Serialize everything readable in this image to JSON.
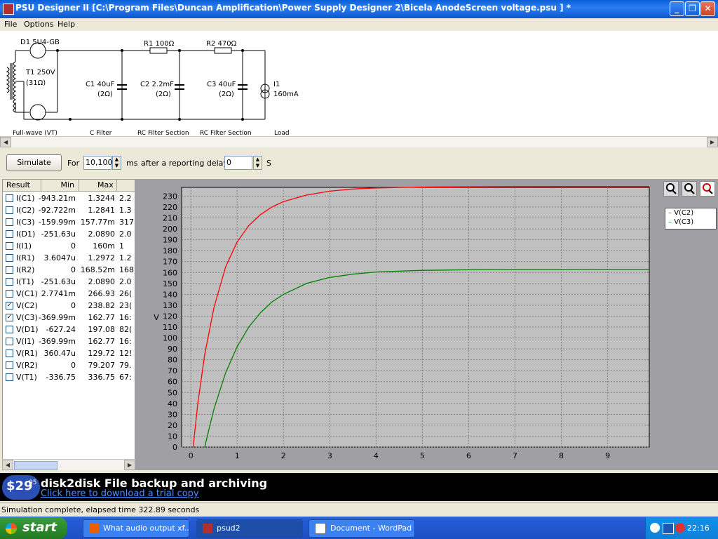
{
  "window": {
    "title": "PSU Designer II  [C:\\Program Files\\Duncan Amplification\\Power Supply Designer 2\\Bicela AnodeScreen voltage.psu ] *",
    "minimize_label": "_",
    "maximize_label": "❐",
    "close_label": "✕"
  },
  "menu": [
    "File",
    "Options",
    "Help"
  ],
  "schematic": {
    "d1": "D1 5U4-GB",
    "t1": "T1 250V",
    "t1_r": "(31Ω)",
    "r1": "R1 100Ω",
    "r2": "R2 470Ω",
    "c1": "C1 40uF",
    "c1_r": "(2Ω)",
    "c2": "C2 2.2mF",
    "c2_r": "(2Ω)",
    "c3": "C3 40uF",
    "c3_r": "(2Ω)",
    "i1": "I1",
    "i1_val": "160mA",
    "sections": [
      "Full-wave (VT)",
      "C Filter",
      "RC Filter Section",
      "RC Filter Section",
      "Load"
    ]
  },
  "controls": {
    "simulate_label": "Simulate",
    "for_label": "For",
    "duration_value": "10,100",
    "ms_label": "ms",
    "delay_label": "after a reporting delay of",
    "delay_value": "0",
    "s_label": "S"
  },
  "results": {
    "headers": [
      "Result",
      "Min",
      "Max"
    ],
    "rows": [
      {
        "name": "I(C1)",
        "min": "-943.21m",
        "max": "1.3244",
        "extra": "2.2",
        "checked": false
      },
      {
        "name": "I(C2)",
        "min": "-92.722m",
        "max": "1.2841",
        "extra": "1.3",
        "checked": false
      },
      {
        "name": "I(C3)",
        "min": "-159.99m",
        "max": "157.77m",
        "extra": "317.",
        "checked": false
      },
      {
        "name": "I(D1)",
        "min": "-251.63u",
        "max": "2.0890",
        "extra": "2.0",
        "checked": false
      },
      {
        "name": "I(I1)",
        "min": "0",
        "max": "160m",
        "extra": "1",
        "checked": false
      },
      {
        "name": "I(R1)",
        "min": "3.6047u",
        "max": "1.2972",
        "extra": "1.2",
        "checked": false
      },
      {
        "name": "I(R2)",
        "min": "0",
        "max": "168.52m",
        "extra": "168.",
        "checked": false
      },
      {
        "name": "I(T1)",
        "min": "-251.63u",
        "max": "2.0890",
        "extra": "2.0",
        "checked": false
      },
      {
        "name": "V(C1)",
        "min": "2.7741m",
        "max": "266.93",
        "extra": "26(",
        "checked": false
      },
      {
        "name": "V(C2)",
        "min": "0",
        "max": "238.82",
        "extra": "23(",
        "checked": true
      },
      {
        "name": "V(C3)",
        "min": "-369.99m",
        "max": "162.77",
        "extra": "16:",
        "checked": true
      },
      {
        "name": "V(D1)",
        "min": "-627.24",
        "max": "197.08",
        "extra": "82(",
        "checked": false
      },
      {
        "name": "V(I1)",
        "min": "-369.99m",
        "max": "162.77",
        "extra": "16:",
        "checked": false
      },
      {
        "name": "V(R1)",
        "min": "360.47u",
        "max": "129.72",
        "extra": "12!",
        "checked": false
      },
      {
        "name": "V(R2)",
        "min": "0",
        "max": "79.207",
        "extra": "79.",
        "checked": false
      },
      {
        "name": "V(T1)",
        "min": "-336.75",
        "max": "336.75",
        "extra": "67:",
        "checked": false
      }
    ]
  },
  "chart_data": {
    "type": "line",
    "ylabel": "V",
    "xlim": [
      -0.2,
      9.9
    ],
    "ylim": [
      0,
      238
    ],
    "xticks": [
      0,
      1,
      2,
      3,
      4,
      5,
      6,
      7,
      8,
      9
    ],
    "yticks": [
      0,
      10,
      20,
      30,
      40,
      50,
      60,
      70,
      80,
      90,
      100,
      110,
      120,
      130,
      140,
      150,
      160,
      170,
      180,
      190,
      200,
      210,
      220,
      230
    ],
    "grid": true,
    "legend_position": "top-right",
    "series": [
      {
        "name": "V(C2)",
        "color": "#ff0000",
        "x": [
          0.05,
          0.15,
          0.3,
          0.5,
          0.75,
          1.0,
          1.25,
          1.5,
          1.75,
          2.0,
          2.5,
          3.0,
          3.5,
          4.0,
          5.0,
          6.0,
          7.0,
          8.0,
          9.0,
          9.9
        ],
        "y": [
          0,
          40,
          85,
          128,
          165,
          188,
          203,
          213,
          220,
          225,
          231,
          234.5,
          236.5,
          237.5,
          238.3,
          238.6,
          238.7,
          238.8,
          238.8,
          238.8
        ]
      },
      {
        "name": "V(C3)",
        "color": "#008000",
        "x": [
          0.3,
          0.4,
          0.5,
          0.75,
          1.0,
          1.25,
          1.5,
          1.75,
          2.0,
          2.5,
          3.0,
          3.5,
          4.0,
          5.0,
          6.0,
          7.0,
          8.0,
          9.0,
          9.9
        ],
        "y": [
          0,
          18,
          35,
          68,
          92,
          110,
          123,
          133,
          140,
          150,
          155.5,
          158.5,
          160.5,
          162,
          162.5,
          162.7,
          162.7,
          162.8,
          162.8
        ]
      }
    ]
  },
  "ad": {
    "price": "$29",
    "price_cents": "95",
    "title": "disk2disk File backup and archiving",
    "link": "Click here to download a trial copy"
  },
  "status": "Simulation complete, elapsed time 322.89 seconds",
  "taskbar": {
    "start_label": "start",
    "tasks": [
      "What audio output xf...",
      "psud2",
      "Document - WordPad"
    ],
    "clock": "22:16"
  },
  "colors": {
    "title_bar": "#0a5fd8",
    "v_c2": "#ff0000",
    "v_c3": "#008000",
    "plot_bg": "#c0c0c0"
  }
}
